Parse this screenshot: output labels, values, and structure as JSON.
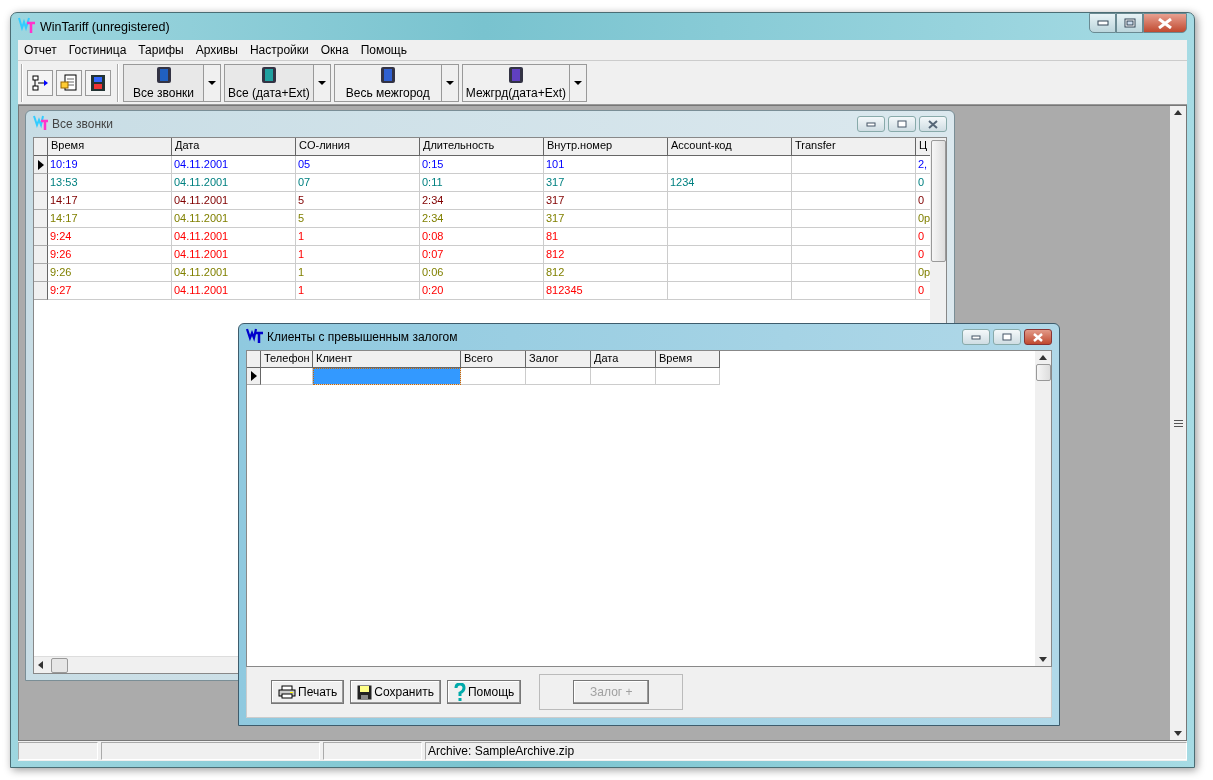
{
  "window": {
    "title": "WinTariff (unregistered)"
  },
  "menu": [
    "Отчет",
    "Гостиница",
    "Тарифы",
    "Архивы",
    "Настройки",
    "Окна",
    "Помощь"
  ],
  "toolbar": {
    "filters": [
      {
        "label": "Все звонки",
        "color": "#2060c0"
      },
      {
        "label": "Все (дата+Ext)",
        "color": "#20a0a0"
      },
      {
        "label": "Весь межгород",
        "color": "#3060d0"
      },
      {
        "label": "Межгрд(дата+Ext)",
        "color": "#6040c0"
      }
    ]
  },
  "calls_window": {
    "title": "Все звонки",
    "columns": [
      "Время",
      "Дата",
      "CO-линия",
      "Длительность",
      "Внутр.номер",
      "Account-код",
      "Transfer",
      "Ц"
    ],
    "rows": [
      {
        "selected": true,
        "color": "#0000ff",
        "cells": [
          "10:19",
          "04.11.2001",
          "05",
          "0:15",
          "101",
          "",
          "",
          "2,"
        ]
      },
      {
        "selected": false,
        "color": "#008080",
        "cells": [
          "13:53",
          "04.11.2001",
          "07",
          "0:11",
          "317",
          "1234",
          "",
          "0"
        ]
      },
      {
        "selected": false,
        "color": "#800000",
        "cells": [
          "14:17",
          "04.11.2001",
          "5",
          "2:34",
          "317",
          "",
          "",
          "0"
        ]
      },
      {
        "selected": false,
        "color": "#808000",
        "cells": [
          "14:17",
          "04.11.2001",
          "5",
          "2:34",
          "317",
          "",
          "",
          "0р"
        ]
      },
      {
        "selected": false,
        "color": "#ff0000",
        "cells": [
          "9:24",
          "04.11.2001",
          "1",
          "0:08",
          "81",
          "",
          "",
          "0"
        ]
      },
      {
        "selected": false,
        "color": "#ff0000",
        "cells": [
          "9:26",
          "04.11.2001",
          "1",
          "0:07",
          "812",
          "",
          "",
          "0"
        ]
      },
      {
        "selected": false,
        "color": "#808000",
        "cells": [
          "9:26",
          "04.11.2001",
          "1",
          "0:06",
          "812",
          "",
          "",
          "0р"
        ]
      },
      {
        "selected": false,
        "color": "#ff0000",
        "cells": [
          "9:27",
          "04.11.2001",
          "1",
          "0:20",
          "812345",
          "",
          "",
          "0"
        ]
      }
    ]
  },
  "clients_window": {
    "title": "Клиенты с превышенным залогом",
    "columns": [
      "Телефон",
      "Клиент",
      "Всего",
      "Залог",
      "Дата",
      "Время"
    ],
    "rows": [
      {
        "selected": true,
        "cells": [
          {
            "selected": false
          },
          {
            "selected": true
          },
          {
            "selected": false
          },
          {
            "selected": false
          },
          {
            "selected": false
          },
          {
            "selected": false
          }
        ]
      }
    ],
    "buttons": [
      {
        "label": "Печать",
        "kind": "print"
      },
      {
        "label": "Сохранить",
        "kind": "save"
      },
      {
        "label": "Помощь",
        "kind": "help"
      }
    ],
    "deposit_button": {
      "label": "Залог +",
      "disabled": true
    }
  },
  "status_bar": {
    "text": "Archive: SampleArchive.zip"
  }
}
